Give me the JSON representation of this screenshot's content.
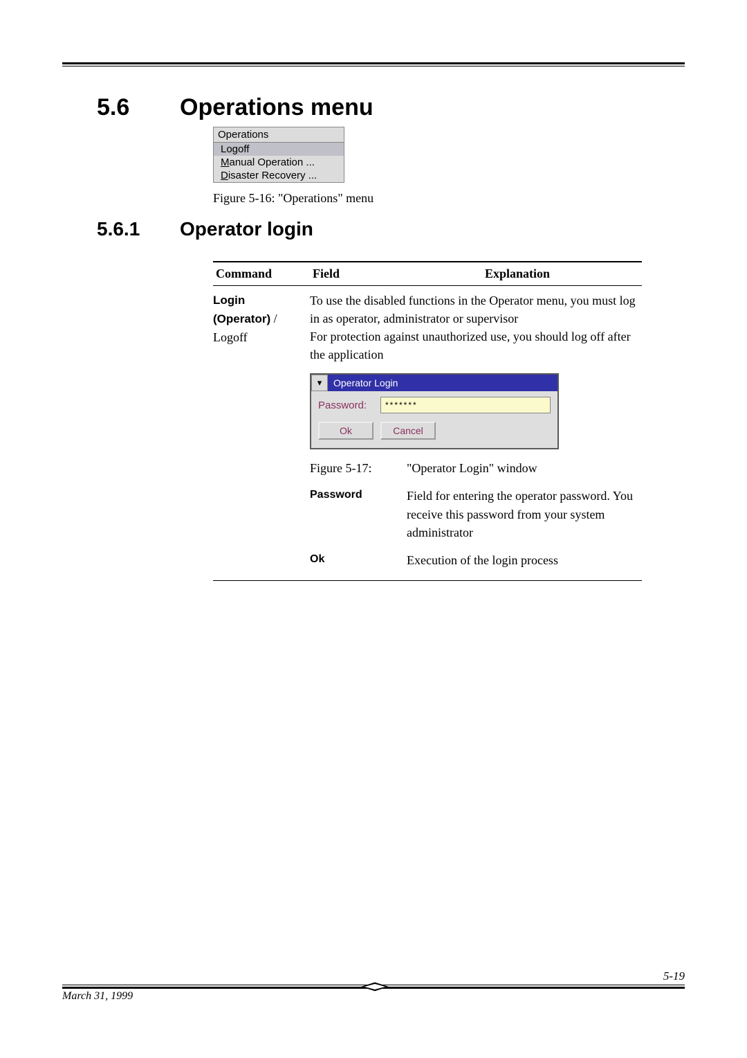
{
  "section": {
    "num": "5.6",
    "title": "Operations menu"
  },
  "subsection": {
    "num": "5.6.1",
    "title": "Operator login"
  },
  "ops_menu": {
    "title_pre": "O",
    "title_rest": "perations",
    "items": [
      {
        "label": "Logoff",
        "ul": "",
        "sel": true
      },
      {
        "label_pre": "M",
        "label_rest": "anual Operation ..."
      },
      {
        "label_pre": "D",
        "label_rest": "isaster Recovery ..."
      }
    ]
  },
  "fig1": "Figure 5-16: \"Operations\" menu",
  "table": {
    "headers": {
      "cmd": "Command",
      "field": "Field",
      "exp": "Explanation"
    },
    "row1": {
      "cmd_lines": [
        "Login",
        "(Operator)",
        "Logoff"
      ],
      "cmd_sep": " / ",
      "exp_para1": "To use the disabled functions in the Operator menu, you must log in as operator, administrator or supervisor",
      "exp_para2": "For protection against unauthorized use, you should log off after the application"
    }
  },
  "login_dialog": {
    "title": "Operator Login",
    "label": "Password:",
    "value": "*******",
    "ok": "Ok",
    "cancel": "Cancel"
  },
  "fig2": {
    "no": "Figure 5-17:",
    "title": "\"Operator Login\" window"
  },
  "defs": {
    "password": {
      "k": "Password",
      "v": "Field for entering the operator password. You receive this password from your system administrator"
    },
    "ok": {
      "k": "Ok",
      "v": "Execution of the login process"
    }
  },
  "footer": {
    "date": "March 31, 1999",
    "page": "5-19"
  }
}
